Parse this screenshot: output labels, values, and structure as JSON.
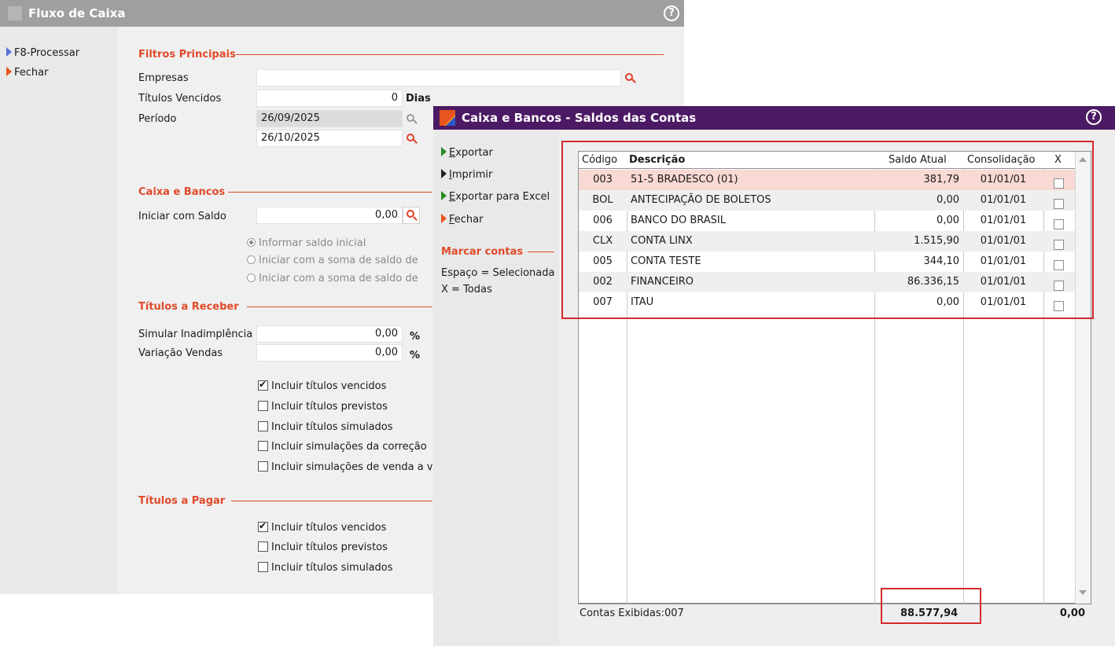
{
  "fluxo": {
    "title": "Fluxo de Caixa",
    "sidebar": [
      {
        "label": "F8-Processar"
      },
      {
        "label": "Fechar"
      }
    ],
    "filtros": {
      "section": "Filtros Principais",
      "empresas_label": "Empresas",
      "empresas_value": "",
      "titulos_vencidos_label": "Títulos Vencidos",
      "titulos_vencidos_value": "0",
      "dias_label": "Dias",
      "periodo_label": "Período",
      "periodo_inicio": "26/09/2025",
      "periodo_fim": "26/10/2025"
    },
    "caixa": {
      "section": "Caixa e Bancos",
      "iniciar_label": "Iniciar com Saldo",
      "iniciar_value": "0,00",
      "radios": [
        {
          "label": "Informar saldo inicial"
        },
        {
          "label": "Iniciar com a soma de saldo de"
        },
        {
          "label": "Iniciar com a soma de saldo de"
        }
      ]
    },
    "receber": {
      "section": "Títulos a Receber",
      "inadimplencia_label": "Simular Inadimplência",
      "inadimplencia_value": "0,00",
      "variacao_label": "Variação Vendas",
      "variacao_value": "0,00",
      "percent": "%",
      "checks": [
        {
          "label": "Incluir títulos vencidos"
        },
        {
          "label": "Incluir títulos previstos"
        },
        {
          "label": "Incluir títulos simulados"
        },
        {
          "label": "Incluir simulações da correção"
        },
        {
          "label": "Incluir simulações de venda a v"
        }
      ]
    },
    "pagar": {
      "section": "Títulos a Pagar",
      "checks": [
        {
          "label": "Incluir títulos vencidos"
        },
        {
          "label": "Incluir títulos previstos"
        },
        {
          "label": "Incluir títulos simulados"
        }
      ]
    }
  },
  "dialog": {
    "title": "Caixa e Bancos - Saldos das Contas",
    "actions": [
      {
        "first": "E",
        "rest": "xportar"
      },
      {
        "first": "I",
        "rest": "mprimir"
      },
      {
        "first": "E",
        "rest": "xportar para Excel"
      },
      {
        "first": "F",
        "rest": "echar"
      }
    ],
    "marcar": {
      "section": "Marcar contas",
      "hint1": "Espaço = Selecionada",
      "hint2": "X = Todas"
    },
    "grid": {
      "headers": {
        "codigo": "Código",
        "descricao": "Descrição",
        "saldo": "Saldo Atual",
        "consolidacao": "Consolidação",
        "x": "X"
      },
      "rows": [
        {
          "codigo": "003",
          "descricao": "51-5 BRADESCO (01)",
          "saldo": "381,79",
          "consolidacao": "01/01/01"
        },
        {
          "codigo": "BOL",
          "descricao": "ANTECIPAÇÃO DE BOLETOS",
          "saldo": "0,00",
          "consolidacao": "01/01/01"
        },
        {
          "codigo": "006",
          "descricao": "BANCO DO BRASIL",
          "saldo": "0,00",
          "consolidacao": "01/01/01"
        },
        {
          "codigo": "CLX",
          "descricao": "CONTA LINX",
          "saldo": "1.515,90",
          "consolidacao": "01/01/01"
        },
        {
          "codigo": "005",
          "descricao": "CONTA TESTE",
          "saldo": "344,10",
          "consolidacao": "01/01/01"
        },
        {
          "codigo": "002",
          "descricao": "FINANCEIRO",
          "saldo": "86.336,15",
          "consolidacao": "01/01/01"
        },
        {
          "codigo": "007",
          "descricao": "ITAU",
          "saldo": "0,00",
          "consolidacao": "01/01/01"
        }
      ],
      "footer_label": "Contas Exibidas:007",
      "footer_total": "88.577,94",
      "footer_x_total": "0,00"
    }
  },
  "colors": {
    "accent": "#e04a2a",
    "dialog_titlebar": "#4b1a64",
    "selected_row": "#f9d9d3",
    "highlight_box": "#d42a2a"
  }
}
